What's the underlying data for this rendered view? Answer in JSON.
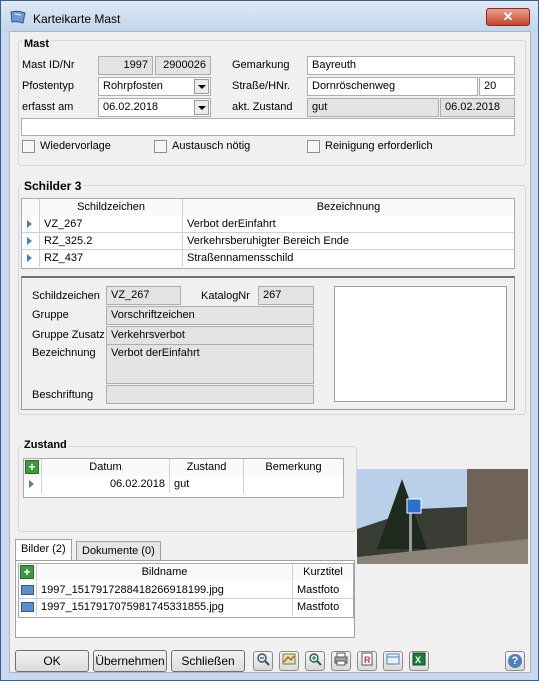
{
  "window": {
    "title": "Karteikarte Mast",
    "close_label": "✕"
  },
  "mast": {
    "section_title": "Mast",
    "id_label": "Mast ID/Nr",
    "id_value1": "1997",
    "id_value2": "2900026",
    "pfostentyp_label": "Pfostentyp",
    "pfostentyp_value": "Rohrpfosten",
    "erfasst_label": "erfasst am",
    "erfasst_value": "06.02.2018",
    "gemarkung_label": "Gemarkung",
    "gemarkung_value": "Bayreuth",
    "strasse_label": "Straße/HNr.",
    "strasse_value": "Dornröschenweg",
    "hnr_value": "20",
    "zustand_label": "akt. Zustand",
    "zustand_value": "gut",
    "zustand_date": "06.02.2018",
    "note_value": "",
    "checkbox_wiedervorlage": "Wiedervorlage",
    "checkbox_austausch": "Austausch nötig",
    "checkbox_reinigung": "Reinigung erforderlich"
  },
  "schilder": {
    "section_title": "Schilder",
    "count": "3",
    "columns": [
      "Schildzeichen",
      "Bezeichnung"
    ],
    "rows": [
      {
        "code": "VZ_267",
        "name": "Verbot derEinfahrt"
      },
      {
        "code": "RZ_325.2",
        "name": "Verkehrsberuhigter Bereich Ende"
      },
      {
        "code": "RZ_437",
        "name": "Straßennamensschild"
      }
    ],
    "detail": {
      "schildzeichen_label": "Schildzeichen",
      "schildzeichen_value": "VZ_267",
      "katalognr_label": "KatalogNr",
      "katalognr_value": "267",
      "gruppe_label": "Gruppe",
      "gruppe_value": "Vorschriftzeichen",
      "gruppe_zusatz_label": "Gruppe Zusatz",
      "gruppe_zusatz_value": "Verkehrsverbot",
      "bezeichnung_label": "Bezeichnung",
      "bezeichnung_value": "Verbot derEinfahrt",
      "beschriftung_label": "Beschriftung",
      "beschriftung_value": ""
    }
  },
  "zustand": {
    "section_title": "Zustand",
    "columns": [
      "Datum",
      "Zustand",
      "Bemerkung"
    ],
    "rows": [
      {
        "datum": "06.02.2018",
        "zustand": "gut",
        "bemerkung": ""
      }
    ]
  },
  "bilder": {
    "tab_bilder": "Bilder (2)",
    "tab_dokumente": "Dokumente (0)",
    "columns": [
      "Bildname",
      "Kurztitel"
    ],
    "rows": [
      {
        "name": "1997_1517917288418266918199.jpg",
        "title": "Mastfoto"
      },
      {
        "name": "1997_1517917075981745331855.jpg",
        "title": "Mastfoto"
      }
    ]
  },
  "footer": {
    "ok_label": "OK",
    "uebernehmen_label": "Übernehmen",
    "schliessen_label": "Schließen",
    "help_label": "?"
  },
  "colors": {
    "accent": "#4f7fb8",
    "window_frame": "#c9d8ec",
    "add_green": "#3c9a3c"
  }
}
